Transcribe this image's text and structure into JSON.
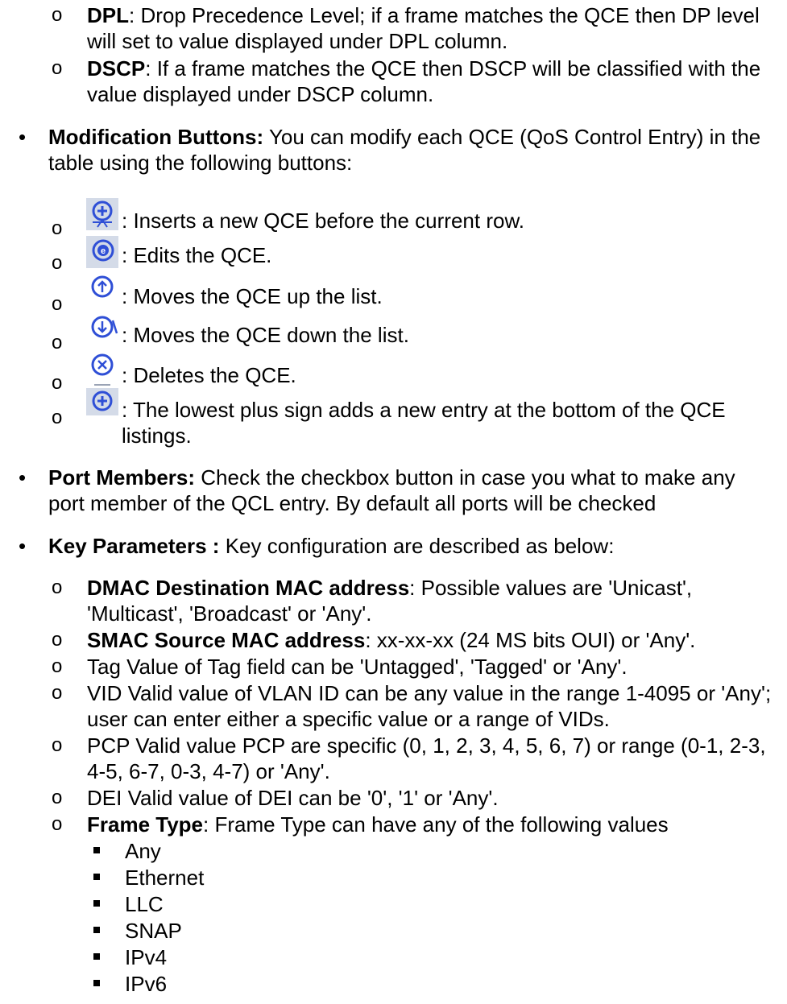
{
  "colors": {
    "icon_blue": "#2f4fd6",
    "icon_bg": "#d4dbe8"
  },
  "section1": {
    "dpl": {
      "term": "DPL",
      "text": ": Drop Precedence Level; if a frame matches the QCE then DP level will set to value displayed under DPL column."
    },
    "dscp": {
      "term": "DSCP",
      "text": ": If a frame matches the QCE then DSCP will be classified with the value displayed under DSCP column."
    }
  },
  "modification": {
    "term": "Modification Buttons:",
    "text": " You can modify each QCE (QoS Control Entry) in the table using the following buttons:",
    "buttons": [
      {
        "icon": "insert-plus-icon",
        "text": ": Inserts a new QCE before the current row."
      },
      {
        "icon": "edit-e-icon",
        "text": ": Edits the QCE."
      },
      {
        "icon": "move-up-icon",
        "text": ": Moves the QCE up the list."
      },
      {
        "icon": "move-down-icon",
        "text": ": Moves the QCE down the list."
      },
      {
        "icon": "delete-x-icon",
        "text": ": Deletes the QCE."
      },
      {
        "icon": "add-plus-icon",
        "text": ": The lowest plus sign adds a new entry at the bottom of the QCE listings."
      }
    ]
  },
  "port_members": {
    "term": "Port Members:",
    "text": " Check the checkbox button in case you what to make any port member of the QCL entry. By default all ports will be checked"
  },
  "key_parameters": {
    "term": "Key Parameters :",
    "text": " Key configuration are described as below:",
    "dmac": {
      "term": "DMAC Destination MAC address",
      "text": ": Possible values are 'Unicast', 'Multicast', 'Broadcast' or 'Any'."
    },
    "smac": {
      "term": "SMAC Source MAC address",
      "text": ": xx-xx-xx (24 MS bits OUI) or 'Any'."
    },
    "tag": "Tag Value of Tag field can be 'Untagged', 'Tagged' or 'Any'.",
    "vid": "VID Valid value of VLAN ID can be any value in the range 1-4095 or 'Any'; user can enter either a specific value or a range of VIDs.",
    "pcp": "PCP Valid value PCP are specific (0, 1, 2, 3, 4, 5, 6, 7) or range (0-1, 2-3, 4-5, 6-7, 0-3, 4-7) or 'Any'.",
    "dei": "DEI Valid value of DEI can be '0', '1' or 'Any'.",
    "frame_type": {
      "term": "Frame Type",
      "text": ": Frame Type can have any of the following values",
      "values": [
        "Any",
        "Ethernet",
        "LLC",
        "SNAP",
        "IPv4",
        "IPv6"
      ]
    }
  }
}
